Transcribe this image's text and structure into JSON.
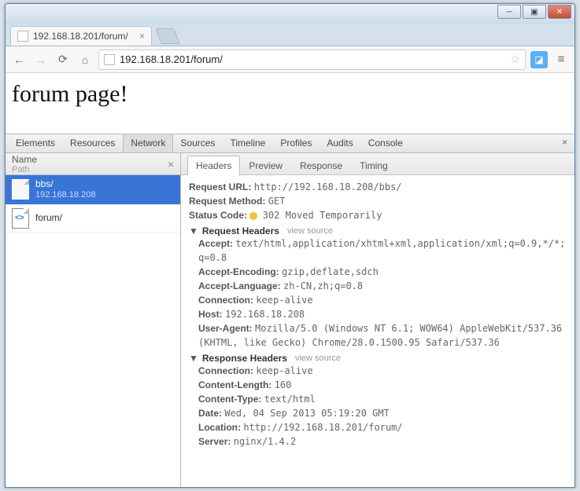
{
  "window": {},
  "tabs": {
    "active": {
      "title": "192.168.18.201/forum/"
    }
  },
  "nav": {
    "url": "192.168.18.201/forum/"
  },
  "page": {
    "heading": "forum page!"
  },
  "devtools": {
    "tabs": [
      "Elements",
      "Resources",
      "Network",
      "Sources",
      "Timeline",
      "Profiles",
      "Audits",
      "Console"
    ],
    "active_tab_index": 2,
    "left": {
      "header_name": "Name",
      "header_path": "Path",
      "requests": [
        {
          "name": "bbs/",
          "host": "192.168.18.208",
          "selected": true,
          "kind": "file"
        },
        {
          "name": "forum/",
          "host": "",
          "selected": false,
          "kind": "html"
        }
      ]
    },
    "right": {
      "tabs": [
        "Headers",
        "Preview",
        "Response",
        "Timing"
      ],
      "active_tab_index": 0,
      "general": {
        "request_url_label": "Request URL:",
        "request_url": "http://192.168.18.208/bbs/",
        "request_method_label": "Request Method:",
        "request_method": "GET",
        "status_code_label": "Status Code:",
        "status_code": "302 Moved Temporarily"
      },
      "request_headers": {
        "title": "Request Headers",
        "view_source": "view source",
        "rows": [
          {
            "k": "Accept:",
            "v": "text/html,application/xhtml+xml,application/xml;q=0.9,*/*;q=0.8"
          },
          {
            "k": "Accept-Encoding:",
            "v": "gzip,deflate,sdch"
          },
          {
            "k": "Accept-Language:",
            "v": "zh-CN,zh;q=0.8"
          },
          {
            "k": "Connection:",
            "v": "keep-alive"
          },
          {
            "k": "Host:",
            "v": "192.168.18.208"
          },
          {
            "k": "User-Agent:",
            "v": "Mozilla/5.0 (Windows NT 6.1; WOW64) AppleWebKit/537.36 (KHTML, like Gecko) Chrome/28.0.1500.95 Safari/537.36"
          }
        ]
      },
      "response_headers": {
        "title": "Response Headers",
        "view_source": "view source",
        "rows": [
          {
            "k": "Connection:",
            "v": "keep-alive"
          },
          {
            "k": "Content-Length:",
            "v": "160"
          },
          {
            "k": "Content-Type:",
            "v": "text/html"
          },
          {
            "k": "Date:",
            "v": "Wed, 04 Sep 2013 05:19:20 GMT"
          },
          {
            "k": "Location:",
            "v": "http://192.168.18.201/forum/"
          },
          {
            "k": "Server:",
            "v": "nginx/1.4.2"
          }
        ]
      }
    }
  }
}
